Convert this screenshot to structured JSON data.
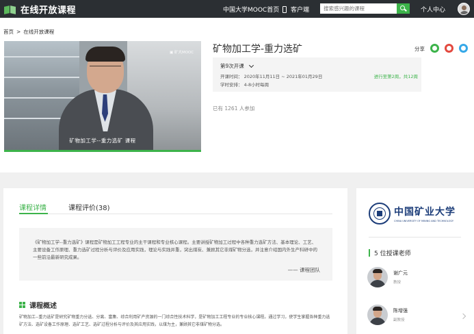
{
  "topbar": {
    "logo_text": "在线开放课程",
    "mooc_link": "中国大学MOOC首页",
    "client_link": "客户端",
    "search_placeholder": "搜索感兴趣的课程",
    "personal_center": "个人中心",
    "bg_color": "#2b2f33",
    "accent_color": "#3cb34a"
  },
  "breadcrumb": {
    "home": "首页",
    "separator": ">",
    "current": "在线开放课程"
  },
  "video": {
    "watermark": "▣ 矿大MOOC",
    "caption": "矿物加工学--重力选矿 课程"
  },
  "course": {
    "title": "矿物加工学-重力选矿",
    "share_label": "分享",
    "session_label": "第9次开课",
    "time_line": "开课时间： 2020年11月11日 ~ 2021年01月29日",
    "schedule_line": "学时安排： 4-8小时每周",
    "progress_text": "进行至第2周，共12周",
    "enrolled": "已有 1261 人参加"
  },
  "tabs": [
    {
      "label": "课程详情",
      "active": true
    },
    {
      "label": "课程评价(38)",
      "active": false
    }
  ],
  "intro": {
    "quote": "《矿物加工学--重力选矿》课程是矿物加工工程专业的主干课程和专业核心课程。主要讲授矿物加工过程中各种重力选矿方法、基本理论、工艺、主要设备工作原理、重力选矿过程分析与评价及应用实践，理论与实践并重，突出煤炭、兼顾其它非煤矿物分选，并注意介绍国内外生产科研中的一些前沿最新研究成果。",
    "signature": "—— 课程团队"
  },
  "overview": {
    "title": "课程概述",
    "text": "矿物加工--重力选矿是研究矿物重力分选、分离、富集、综合利用矿产资源的一门综合性技术科学，是矿物加工工程专业的专业核心课程。通过学习，使学生掌握各种重力选矿方法、选矿设备工作原理、选矿工艺、选矿过程分析与评价及其应用实践，以煤为主，兼顾其它非煤矿物分选。"
  },
  "sidebar": {
    "university_cn": "中国矿业大学",
    "university_en": "CHINA UNIVERSITY OF MINING AND TECHNOLOGY",
    "teachers_title": "5 位授课老师",
    "teachers": [
      {
        "name": "谢广元",
        "role": "教授"
      },
      {
        "name": "陈增强",
        "role": "副教授"
      }
    ]
  }
}
